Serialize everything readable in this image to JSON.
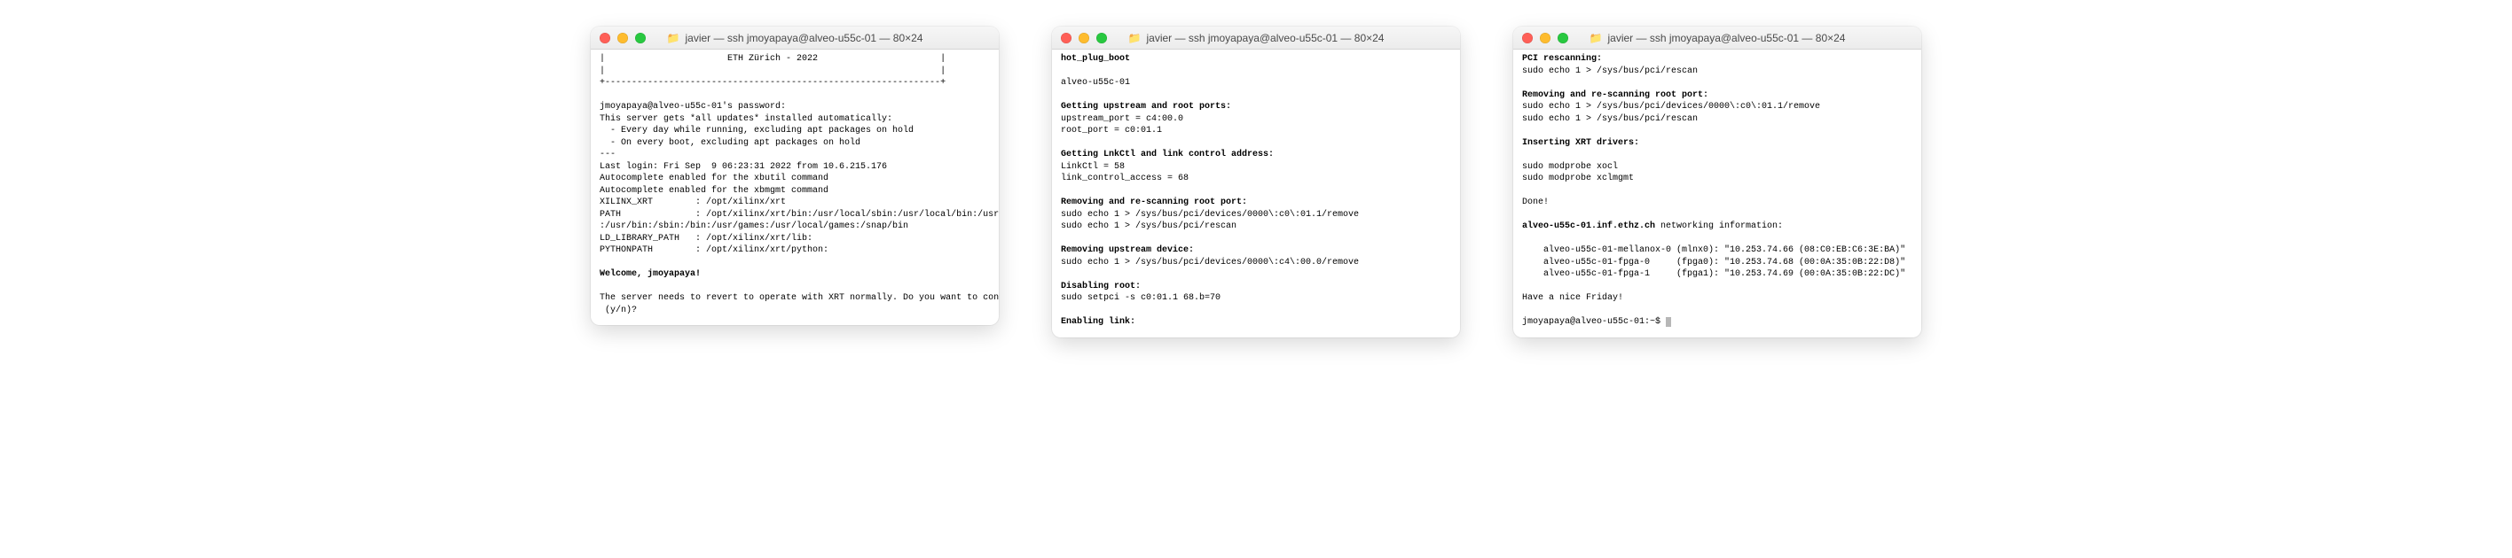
{
  "windows": [
    {
      "title": "javier — ssh jmoyapaya@alveo-u55c-01 — 80×24",
      "lines": [
        {
          "t": "|                       ETH Zürich - 2022                       |",
          "b": false
        },
        {
          "t": "|                                                               |",
          "b": false
        },
        {
          "t": "+---------------------------------------------------------------+",
          "b": false
        },
        {
          "t": "",
          "b": false
        },
        {
          "t": "jmoyapaya@alveo-u55c-01's password:",
          "b": false
        },
        {
          "t": "This server gets *all updates* installed automatically:",
          "b": false
        },
        {
          "t": "  - Every day while running, excluding apt packages on hold",
          "b": false
        },
        {
          "t": "  - On every boot, excluding apt packages on hold",
          "b": false
        },
        {
          "t": "---",
          "b": false
        },
        {
          "t": "Last login: Fri Sep  9 06:23:31 2022 from 10.6.215.176",
          "b": false
        },
        {
          "t": "Autocomplete enabled for the xbutil command",
          "b": false
        },
        {
          "t": "Autocomplete enabled for the xbmgmt command",
          "b": false
        },
        {
          "t": "XILINX_XRT        : /opt/xilinx/xrt",
          "b": false
        },
        {
          "t": "PATH              : /opt/xilinx/xrt/bin:/usr/local/sbin:/usr/local/bin:/usr/sbin",
          "b": false
        },
        {
          "t": ":/usr/bin:/sbin:/bin:/usr/games:/usr/local/games:/snap/bin",
          "b": false
        },
        {
          "t": "LD_LIBRARY_PATH   : /opt/xilinx/xrt/lib:",
          "b": false
        },
        {
          "t": "PYTHONPATH        : /opt/xilinx/xrt/python:",
          "b": false
        },
        {
          "t": "",
          "b": false
        },
        {
          "t": "Welcome, jmoyapaya!",
          "b": true
        },
        {
          "t": "",
          "b": false
        },
        {
          "t": "The server needs to revert to operate with XRT normally. Do you want to continue",
          "b": false
        },
        {
          "t": " (y/n)?",
          "b": false
        }
      ]
    },
    {
      "title": "javier — ssh jmoyapaya@alveo-u55c-01 — 80×24",
      "lines": [
        {
          "t": "hot_plug_boot",
          "b": true
        },
        {
          "t": "",
          "b": false
        },
        {
          "t": "alveo-u55c-01",
          "b": false
        },
        {
          "t": "",
          "b": false
        },
        {
          "t": "Getting upstream and root ports:",
          "b": true
        },
        {
          "t": "upstream_port = c4:00.0",
          "b": false
        },
        {
          "t": "root_port = c0:01.1",
          "b": false
        },
        {
          "t": "",
          "b": false
        },
        {
          "t": "Getting LnkCtl and link control address:",
          "b": true
        },
        {
          "t": "LinkCtl = 58",
          "b": false
        },
        {
          "t": "link_control_access = 68",
          "b": false
        },
        {
          "t": "",
          "b": false
        },
        {
          "t": "Removing and re-scanning root port:",
          "b": true
        },
        {
          "t": "sudo echo 1 > /sys/bus/pci/devices/0000\\:c0\\:01.1/remove",
          "b": false
        },
        {
          "t": "sudo echo 1 > /sys/bus/pci/rescan",
          "b": false
        },
        {
          "t": "",
          "b": false
        },
        {
          "t": "Removing upstream device:",
          "b": true
        },
        {
          "t": "sudo echo 1 > /sys/bus/pci/devices/0000\\:c4\\:00.0/remove",
          "b": false
        },
        {
          "t": "",
          "b": false
        },
        {
          "t": "Disabling root:",
          "b": true
        },
        {
          "t": "sudo setpci -s c0:01.1 68.b=70",
          "b": false
        },
        {
          "t": "",
          "b": false
        },
        {
          "t": "Enabling link:",
          "b": true
        }
      ]
    },
    {
      "title": "javier — ssh jmoyapaya@alveo-u55c-01 — 80×24",
      "lines": [
        {
          "t": "PCI rescanning:",
          "b": true
        },
        {
          "t": "sudo echo 1 > /sys/bus/pci/rescan",
          "b": false
        },
        {
          "t": "",
          "b": false
        },
        {
          "t": "Removing and re-scanning root port:",
          "b": true
        },
        {
          "t": "sudo echo 1 > /sys/bus/pci/devices/0000\\:c0\\:01.1/remove",
          "b": false
        },
        {
          "t": "sudo echo 1 > /sys/bus/pci/rescan",
          "b": false
        },
        {
          "t": "",
          "b": false
        },
        {
          "t": "Inserting XRT drivers:",
          "b": true
        },
        {
          "t": "",
          "b": false
        },
        {
          "t": "sudo modprobe xocl",
          "b": false
        },
        {
          "t": "sudo modprobe xclmgmt",
          "b": false
        },
        {
          "t": "",
          "b": false
        },
        {
          "t": "Done!",
          "b": false
        },
        {
          "t": "",
          "b": false
        },
        {
          "t": "alveo-u55c-01.inf.ethz.ch",
          "b": true,
          "suffix": " networking information:"
        },
        {
          "t": "",
          "b": false
        },
        {
          "t": "    alveo-u55c-01-mellanox-0 (mlnx0): \"10.253.74.66 (08:C0:EB:C6:3E:BA)\"",
          "b": false
        },
        {
          "t": "    alveo-u55c-01-fpga-0     (fpga0): \"10.253.74.68 (00:0A:35:0B:22:D8)\"",
          "b": false
        },
        {
          "t": "    alveo-u55c-01-fpga-1     (fpga1): \"10.253.74.69 (00:0A:35:0B:22:DC)\"",
          "b": false
        },
        {
          "t": "",
          "b": false
        },
        {
          "t": "Have a nice Friday!",
          "b": false
        },
        {
          "t": "",
          "b": false
        },
        {
          "t": "jmoyapaya@alveo-u55c-01:~$ ",
          "b": false,
          "cursor": true
        }
      ]
    }
  ],
  "colors": {
    "red": "#ff5f57",
    "yellow": "#febc2e",
    "green": "#28c840"
  }
}
